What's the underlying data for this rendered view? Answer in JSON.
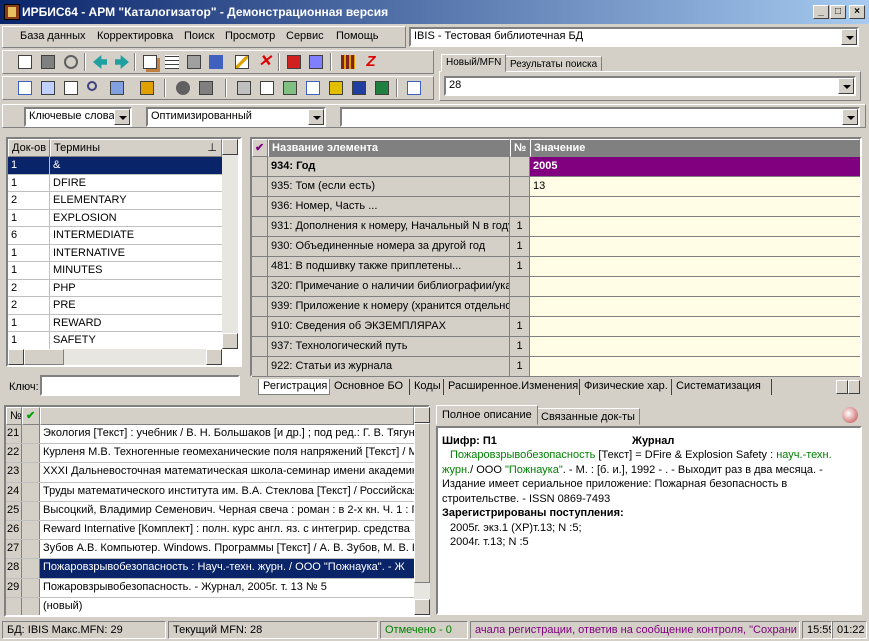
{
  "window": {
    "title": "ИРБИС64 - АРМ \"Каталогизатор\" - Демонстрационная версия",
    "minimize": "_",
    "maximize": "□",
    "close": "×"
  },
  "menu": [
    "База данных",
    "Корректировка",
    "Поиск",
    "Просмотр",
    "Сервис",
    "Помощь"
  ],
  "database_combo": {
    "value": "IBIS - Тестовая библиотечная БД"
  },
  "mfn_tabs": {
    "new_mfn": "Новый/MFN",
    "search_results": "Результаты поиска"
  },
  "mfn_combo": {
    "value": "28"
  },
  "search_bar": {
    "mode": "Ключевые слова",
    "method": "Оптимизированный",
    "query": ""
  },
  "dictionary": {
    "col_docs": "Док-ов",
    "col_terms": "Термины",
    "rows": [
      {
        "count": "1",
        "term": "&"
      },
      {
        "count": "1",
        "term": "DFIRE"
      },
      {
        "count": "2",
        "term": "ELEMENTARY"
      },
      {
        "count": "1",
        "term": "EXPLOSION"
      },
      {
        "count": "6",
        "term": "INTERMEDIATE"
      },
      {
        "count": "1",
        "term": "INTERNATIVE"
      },
      {
        "count": "1",
        "term": "MINUTES"
      },
      {
        "count": "2",
        "term": "PHP"
      },
      {
        "count": "2",
        "term": "PRE"
      },
      {
        "count": "1",
        "term": "REWARD"
      },
      {
        "count": "1",
        "term": "SAFETY"
      }
    ],
    "key_label": "Ключ:",
    "key_value": ""
  },
  "fields": {
    "col_name": "Название элемента",
    "col_num": "№",
    "col_value": "Значение",
    "rows": [
      {
        "name": "934: Год",
        "num": "",
        "value": "2005",
        "selected": true
      },
      {
        "name": "935: Том (если есть)",
        "num": "",
        "value": "13"
      },
      {
        "name": "936: Номер, Часть ...",
        "num": "",
        "value": ""
      },
      {
        "name": "931: Дополнения к номеру, Начальный N в году",
        "num": "1",
        "value": ""
      },
      {
        "name": "930: Объединенные номера за другой год",
        "num": "1",
        "value": ""
      },
      {
        "name": "481: В подшивку также приплетены...",
        "num": "1",
        "value": ""
      },
      {
        "name": "320: Примечание о наличии библиографии/указ",
        "num": "",
        "value": ""
      },
      {
        "name": "939: Приложение к номеру (хранится отдельно",
        "num": "",
        "value": ""
      },
      {
        "name": "910: Сведения  об ЭКЗЕМПЛЯРАХ",
        "num": "1",
        "value": ""
      },
      {
        "name": "937: Технологический путь",
        "num": "1",
        "value": ""
      },
      {
        "name": "922: Статьи из журнала",
        "num": "1",
        "value": ""
      }
    ],
    "tabs": [
      "Регистрация",
      "Основное БО",
      "Коды",
      "Расширенное.Изменения",
      "Физические хар.",
      "Систематизация"
    ]
  },
  "records": {
    "col_num": "№",
    "rows": [
      {
        "num": "21",
        "text": "Экология [Текст] : учебник / В. Н. Большаков [и др.] ; под ред.: Г. В. Тягунов"
      },
      {
        "num": "22",
        "text": "Курленя М.В. Техногенные геомеханические поля напряжений [Текст] / М."
      },
      {
        "num": "23",
        "text": "XXXI Дальневосточная математическая школа-семинар имени академика"
      },
      {
        "num": "24",
        "text": "Труды математического института им. В.А. Стеклова [Текст] / Российская"
      },
      {
        "num": "25",
        "text": "Высоцкий, Владимир Семенович. Черная свеча : роман : в 2-х кн. Ч. 1 : П"
      },
      {
        "num": "26",
        "text": "Reward Internative [Комплект] : полн. курс англ. яз. с интегрир. средства"
      },
      {
        "num": "27",
        "text": "Зубов А.В. Компьютер. Windows. Программы [Текст] / А. В. Зубов, М. В. Н"
      },
      {
        "num": "28",
        "text": "Пожаровзрывобезопасность : Науч.-техн. журн. / ООО \"Пожнаука\". - Ж",
        "selected": true
      },
      {
        "num": "29",
        "text": "Пожаровзрывобезопасность. - Журнал, 2005г. т. 13 № 5"
      },
      {
        "num": "",
        "text": "(новый)"
      }
    ]
  },
  "description": {
    "tab_full": "Полное описание",
    "tab_linked": "Связанные док-ты",
    "shifr_label": "Шифр: П1",
    "kind": "Журнал",
    "title_link": "Пожаровзрывобезопасность",
    "part1": " [Текст] = DFire & Explosion Safety : ",
    "link2": "науч.-техн. журн.",
    "part2": "/ ООО ",
    "link3": "\"Пожнаука\"",
    "part3": ". - М. : [б. и.], 1992 -      . - Выходит раз в два месяца. - Издание имеет сериальное приложение: Пожарная безопасность в строительстве. - ISSN 0869-7493",
    "registered": "Зарегистрированы поступления:",
    "reg1": "2005г. экз.1 (ХР)т.13; N :5;",
    "reg2": "2004г. т.13; N :5"
  },
  "statusbar": {
    "db": "БД: IBIS Макс.MFN: 29",
    "current": "Текущий MFN: 28",
    "marked": "Отмечено - 0",
    "message": "ачала регистрации, ответив на сообщение контроля, \"Сохрани",
    "time1": "15:59",
    "time2": "01:22"
  },
  "colors": {
    "selection": "#0a246a",
    "field_selected": "#800080",
    "value_bg": "#fffde6",
    "status_green": "#008000",
    "status_purple": "#800080",
    "link_green": "#008000"
  }
}
